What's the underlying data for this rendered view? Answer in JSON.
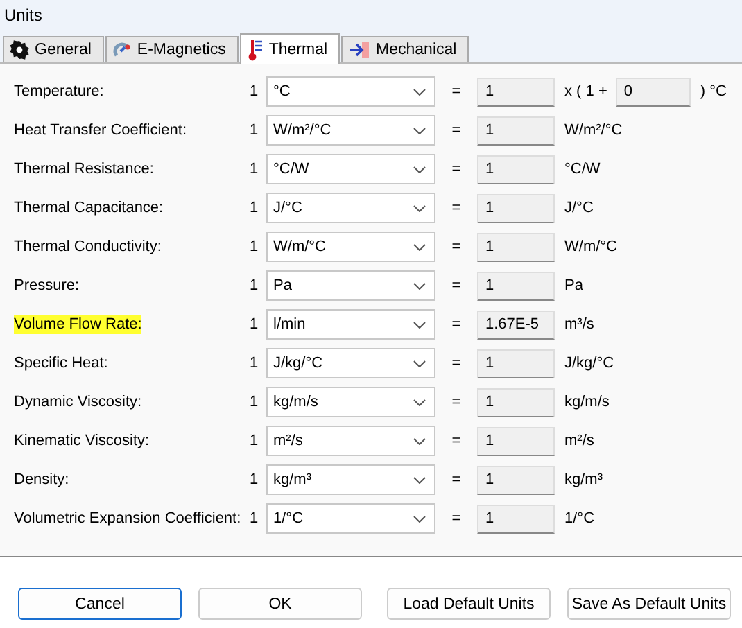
{
  "window": {
    "title": "Units"
  },
  "tabs": [
    {
      "label": "General",
      "kind": "gear",
      "selected": false
    },
    {
      "label": "E-Magnetics",
      "kind": "magnet",
      "selected": false
    },
    {
      "label": "Thermal",
      "kind": "thermometer",
      "selected": true
    },
    {
      "label": "Mechanical",
      "kind": "arrow",
      "selected": false
    }
  ],
  "rows": [
    {
      "kind": "offset",
      "label": "Temperature:",
      "highlighted": false,
      "factor": "1",
      "unit": "°C",
      "equals": "=",
      "value": "1",
      "offset_prefix": "x ( 1 +",
      "offset_value": "0",
      "offset_suffix": ") °C"
    },
    {
      "kind": "plain",
      "label": "Heat Transfer Coefficient:",
      "highlighted": false,
      "factor": "1",
      "unit": "W/m²/°C",
      "equals": "=",
      "value": "1",
      "base_unit": "W/m²/°C"
    },
    {
      "kind": "plain",
      "label": "Thermal Resistance:",
      "highlighted": false,
      "factor": "1",
      "unit": "°C/W",
      "equals": "=",
      "value": "1",
      "base_unit": "°C/W"
    },
    {
      "kind": "plain",
      "label": "Thermal Capacitance:",
      "highlighted": false,
      "factor": "1",
      "unit": "J/°C",
      "equals": "=",
      "value": "1",
      "base_unit": "J/°C"
    },
    {
      "kind": "plain",
      "label": "Thermal Conductivity:",
      "highlighted": false,
      "factor": "1",
      "unit": "W/m/°C",
      "equals": "=",
      "value": "1",
      "base_unit": "W/m/°C"
    },
    {
      "kind": "plain",
      "label": "Pressure:",
      "highlighted": false,
      "factor": "1",
      "unit": "Pa",
      "equals": "=",
      "value": "1",
      "base_unit": "Pa"
    },
    {
      "kind": "plain",
      "label": "Volume Flow Rate:",
      "highlighted": true,
      "factor": "1",
      "unit": "l/min",
      "equals": "=",
      "value": "1.67E-5",
      "base_unit": "m³/s"
    },
    {
      "kind": "plain",
      "label": "Specific Heat:",
      "highlighted": false,
      "factor": "1",
      "unit": "J/kg/°C",
      "equals": "=",
      "value": "1",
      "base_unit": "J/kg/°C"
    },
    {
      "kind": "plain",
      "label": "Dynamic Viscosity:",
      "highlighted": false,
      "factor": "1",
      "unit": "kg/m/s",
      "equals": "=",
      "value": "1",
      "base_unit": "kg/m/s"
    },
    {
      "kind": "plain",
      "label": "Kinematic Viscosity:",
      "highlighted": false,
      "factor": "1",
      "unit": "m²/s",
      "equals": "=",
      "value": "1",
      "base_unit": "m²/s"
    },
    {
      "kind": "plain",
      "label": "Density:",
      "highlighted": false,
      "factor": "1",
      "unit": "kg/m³",
      "equals": "=",
      "value": "1",
      "base_unit": "kg/m³"
    },
    {
      "kind": "plain",
      "label": "Volumetric Expansion Coefficient:",
      "highlighted": false,
      "factor": "1",
      "unit": "1/°C",
      "equals": "=",
      "value": "1",
      "base_unit": "1/°C"
    }
  ],
  "buttons": [
    {
      "label": "Cancel",
      "focused": true
    },
    {
      "label": "OK",
      "focused": false
    },
    {
      "label": "Load Default Units",
      "focused": false
    },
    {
      "label": "Save As Default Units",
      "focused": false
    }
  ]
}
